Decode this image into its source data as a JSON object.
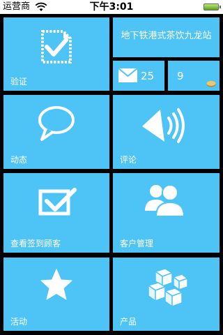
{
  "status_bar": {
    "carrier": "运营商",
    "time": "下午3:01"
  },
  "tiles": {
    "verify": {
      "label": "验证",
      "icon": "verified-document-icon"
    },
    "store": {
      "name": "地下铁港式茶饮九龙站"
    },
    "messages": {
      "count": "25",
      "icon": "envelope-icon"
    },
    "coins": {
      "count": "9",
      "icon": "coin-icon"
    },
    "dynamic": {
      "label": "动态",
      "icon": "speech-bubble-icon"
    },
    "review": {
      "label": "评论",
      "icon": "speaker-icon"
    },
    "checkin": {
      "label": "查看签到顾客",
      "icon": "checkbox-icon"
    },
    "customer": {
      "label": "客户管理",
      "icon": "users-icon"
    },
    "activity": {
      "label": "活动",
      "icon": "star-icon"
    },
    "product": {
      "label": "产品",
      "icon": "cubes-icon"
    }
  },
  "colors": {
    "tile": "#4ec3f5",
    "background": "#000000",
    "text": "#ffffff"
  }
}
